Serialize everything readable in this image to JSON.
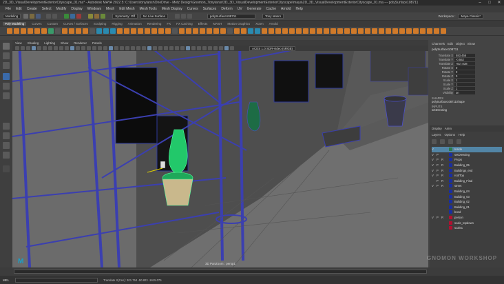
{
  "window": {
    "title": "2D_3D_VisualDevelopmentExteriorCityscape_01.ma* - Autodesk MAYA 2022.5: C:\\Users\\tonyiansr\\OneDrive - Metz Design\\Gnomon_Tonyiansr\\2D_3D_VisualDevelopmentExteriorCityscape\\maya\\2D_3D_VisualDevelopmentExteriorCityscape_01.ma --- polySurface108711"
  },
  "menubar": [
    "File",
    "Edit",
    "Create",
    "Select",
    "Modify",
    "Display",
    "Windows",
    "Mesh",
    "Edit Mesh",
    "Mesh Tools",
    "Mesh Display",
    "Curves",
    "Surfaces",
    "Deform",
    "UV",
    "Generate",
    "Cache",
    "Arnold",
    "Help"
  ],
  "statusline": {
    "mode": "Modeling",
    "symmetry": "Symmetry: Off",
    "live_surface": "No Live Surface",
    "object_field": "polySurface108711",
    "camera_menu": "Tony Iansro",
    "workspace_label": "Workspace :",
    "workspace_value": "Maya Classic*"
  },
  "shelf_tabs": [
    "Poly Modeling",
    "Curves",
    "Custom",
    "Curves / Surfaces",
    "Sculpting",
    "Rigging",
    "Animation",
    "Rendering",
    "FX",
    "FX Caching",
    "Effects",
    "MASH",
    "Motion Graphics",
    "XGen",
    "Arnold"
  ],
  "viewport": {
    "menus": [
      "View",
      "Shading",
      "Lighting",
      "Show",
      "Renderer",
      "Panels"
    ],
    "camera_label": "3D PanZoom : persp1",
    "readout": "ACES 1.0 SDR-video (sRGB)"
  },
  "channel_box": {
    "tabs": [
      "Channels",
      "Edit",
      "Object",
      "Show"
    ],
    "object_name": "polySurface108711",
    "attributes": [
      {
        "label": "Translate X",
        "value": "583.456"
      },
      {
        "label": "Translate Y",
        "value": "-0.552"
      },
      {
        "label": "Translate Z",
        "value": "-817.038"
      },
      {
        "label": "Rotate X",
        "value": "0"
      },
      {
        "label": "Rotate Y",
        "value": "0"
      },
      {
        "label": "Rotate Z",
        "value": "0"
      },
      {
        "label": "Scale X",
        "value": "1"
      },
      {
        "label": "Scale Y",
        "value": "1"
      },
      {
        "label": "Scale Z",
        "value": "1"
      },
      {
        "label": "Visibility",
        "value": "on"
      }
    ],
    "shapes_header": "SHAPES",
    "shape_name": "polySurface108711Shape",
    "inputs_header": "INPUTS",
    "input_name": "setDressing"
  },
  "layer_editor": {
    "tabs": [
      "Display",
      "Anim"
    ],
    "menus": [
      "Layers",
      "Options",
      "Help"
    ],
    "layers": [
      {
        "v": "V",
        "p": "",
        "r": "",
        "color": "#2d7a4a",
        "name": "Inside",
        "selected": true
      },
      {
        "v": "V",
        "p": "P",
        "r": "",
        "color": "#1a2ea0",
        "name": "setDressing",
        "selected": false
      },
      {
        "v": "V",
        "p": "P",
        "r": "R",
        "color": "#1a2ea0",
        "name": "Props",
        "selected": false
      },
      {
        "v": "V",
        "p": "P",
        "r": "R",
        "color": "#1a2ea0",
        "name": "Building_05",
        "selected": false
      },
      {
        "v": "V",
        "p": "P",
        "r": "R",
        "color": "#1a2ea0",
        "name": "Buildings_end",
        "selected": false
      },
      {
        "v": "V",
        "p": "P",
        "r": "R",
        "color": "#1a2ea0",
        "name": "roofTop",
        "selected": false
      },
      {
        "v": "",
        "p": "P",
        "r": "R",
        "color": "#1a2ea0",
        "name": "Building_Final",
        "selected": false
      },
      {
        "v": "V",
        "p": "P",
        "r": "R",
        "color": "#1a2ea0",
        "name": "street",
        "selected": false
      },
      {
        "v": "",
        "p": "",
        "r": "",
        "color": "#1a2ea0",
        "name": "Building_04",
        "selected": false
      },
      {
        "v": "",
        "p": "",
        "r": "",
        "color": "#1a2ea0",
        "name": "Building_03",
        "selected": false
      },
      {
        "v": "",
        "p": "",
        "r": "",
        "color": "#1a2ea0",
        "name": "Building_02",
        "selected": false
      },
      {
        "v": "",
        "p": "",
        "r": "",
        "color": "#1a2ea0",
        "name": "Building_01",
        "selected": false
      },
      {
        "v": "",
        "p": "",
        "r": "",
        "color": "#1a2ea0",
        "name": "bond",
        "selected": false
      },
      {
        "v": "V",
        "p": "P",
        "r": "R",
        "color": "#b01030",
        "name": "person",
        "selected": false
      },
      {
        "v": "",
        "p": "",
        "r": "",
        "color": "#b01030",
        "name": "scale_topdown",
        "selected": false
      },
      {
        "v": "",
        "p": "",
        "r": "",
        "color": "#b01030",
        "name": "scale1",
        "selected": false
      }
    ]
  },
  "bottombar": {
    "cmd_lang": "MEL",
    "help_text": "Translate X(Cen): 301.754   -50.803   -1615.075"
  },
  "watermark": "GNOMON WORKSHOP"
}
